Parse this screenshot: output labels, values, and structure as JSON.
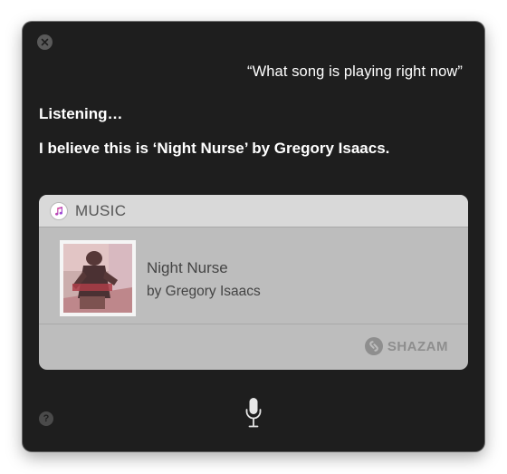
{
  "query": "“What song is playing right now”",
  "status": "Listening…",
  "response": "I believe this is ‘Night Nurse’ by Gregory Isaacs.",
  "card": {
    "title": "MUSIC",
    "icon": "music-note-icon",
    "track": {
      "title": "Night Nurse",
      "artist": "by Gregory Isaacs"
    },
    "provider": "SHAZAM"
  },
  "icons": {
    "close": "close-icon",
    "help": "help-icon",
    "mic": "microphone-icon",
    "shazam": "shazam-logo-icon"
  },
  "help_glyph": "?",
  "colors": {
    "window_bg": "#1e1e1e",
    "card_bg": "#bdbdbd",
    "card_header_bg": "#d9d9d9",
    "text_primary": "#ffffff",
    "text_card": "#444444"
  }
}
